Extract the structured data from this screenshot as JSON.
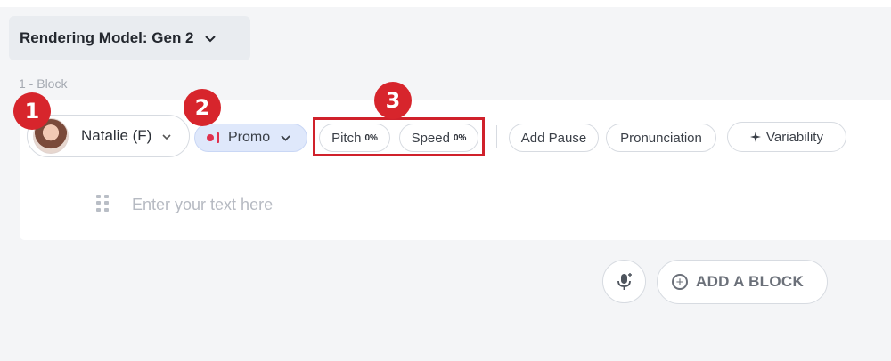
{
  "header": {
    "model_select_label": "Rendering Model: Gen 2",
    "chevron_icon": "chevron-down-icon"
  },
  "block": {
    "label": "1 -  Block",
    "voice": {
      "name": "Natalie (F)",
      "avatar_icon": "avatar"
    },
    "style": {
      "name": "Promo",
      "accent_color": "#e0304e"
    },
    "pitch": {
      "label": "Pitch",
      "value": "0%"
    },
    "speed": {
      "label": "Speed",
      "value": "0%"
    },
    "buttons": {
      "add_pause": "Add Pause",
      "pronunciation": "Pronunciation",
      "variability": "Variability"
    },
    "text_placeholder": "Enter your text here"
  },
  "annotations": {
    "badge1": "1",
    "badge2": "2",
    "badge3": "3",
    "highlight_color": "#d0212b"
  },
  "footer": {
    "add_block_label": "ADD A BLOCK",
    "mic_icon": "mic-icon"
  }
}
